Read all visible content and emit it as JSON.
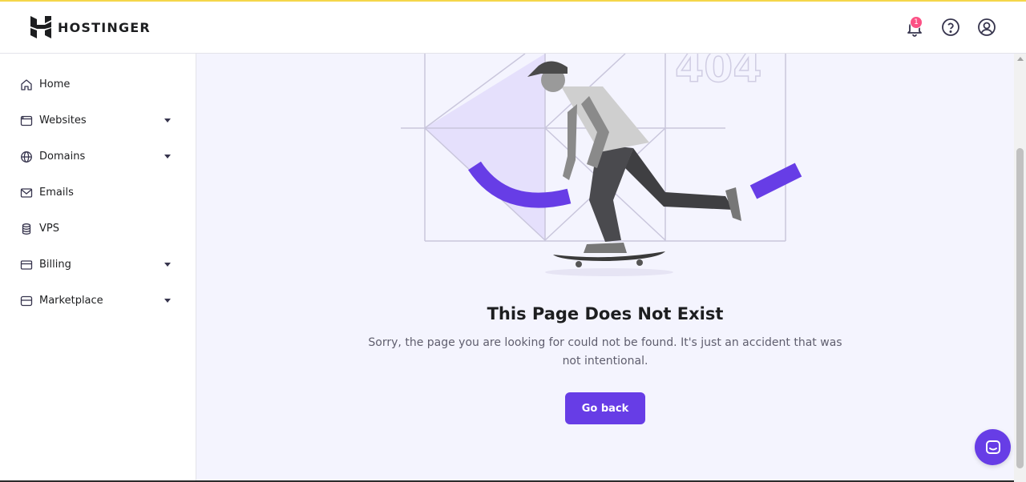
{
  "brand": {
    "name": "HOSTINGER",
    "accent": "#673de6",
    "badge_color": "#fc5185"
  },
  "header": {
    "notifications_count": "1",
    "icons": [
      "bell-icon",
      "help-icon",
      "account-icon"
    ]
  },
  "sidebar": {
    "items": [
      {
        "label": "Home",
        "icon": "home-icon",
        "has_dropdown": false
      },
      {
        "label": "Websites",
        "icon": "browser-window-icon",
        "has_dropdown": true
      },
      {
        "label": "Domains",
        "icon": "globe-icon",
        "has_dropdown": true
      },
      {
        "label": "Emails",
        "icon": "mail-icon",
        "has_dropdown": false
      },
      {
        "label": "VPS",
        "icon": "server-icon",
        "has_dropdown": false
      },
      {
        "label": "Billing",
        "icon": "credit-card-icon",
        "has_dropdown": true
      },
      {
        "label": "Marketplace",
        "icon": "store-icon",
        "has_dropdown": true
      }
    ]
  },
  "main": {
    "illustration_text": "404",
    "title": "This Page Does Not Exist",
    "description": "Sorry, the page you are looking for could not be found. It's just an accident that was not intentional.",
    "button_label": "Go back"
  }
}
